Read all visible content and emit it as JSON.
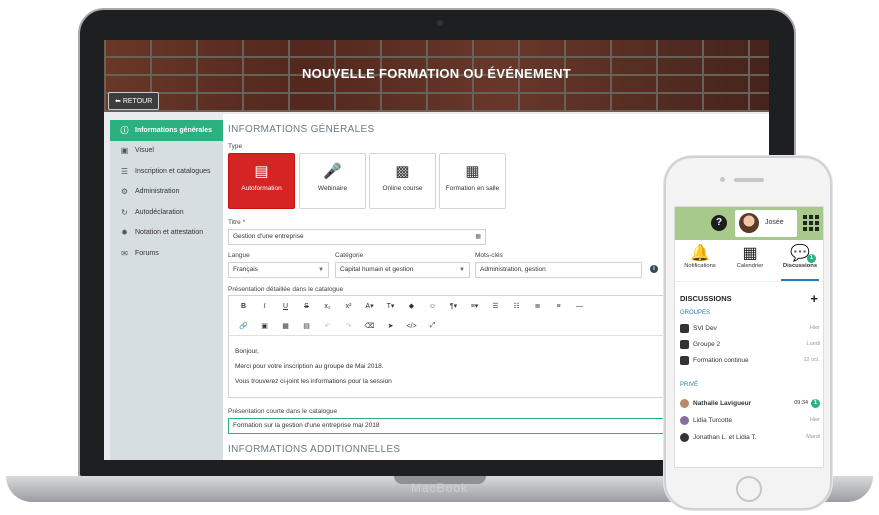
{
  "app": {
    "page_title": "NOUVELLE FORMATION OU ÉVÉNEMENT",
    "back_label": "RETOUR",
    "device_brand": "MacBook"
  },
  "sidebar": {
    "items": [
      {
        "label": "Informations générales",
        "icon": "info-icon",
        "active": true
      },
      {
        "label": "Visuel",
        "icon": "image-icon"
      },
      {
        "label": "Inscription et catalogues",
        "icon": "list-icon"
      },
      {
        "label": "Administration",
        "icon": "gear-icon"
      },
      {
        "label": "Autodéclaration",
        "icon": "sync-icon"
      },
      {
        "label": "Notation et attestation",
        "icon": "badge-icon"
      },
      {
        "label": "Forums",
        "icon": "chat-icon"
      }
    ]
  },
  "form": {
    "section_general": "INFORMATIONS GÉNÉRALES",
    "type_label": "Type",
    "types": [
      {
        "label": "Autoformation",
        "selected": true
      },
      {
        "label": "Webinaire"
      },
      {
        "label": "Online course"
      },
      {
        "label": "Formation en salle"
      }
    ],
    "title_label": "Titre *",
    "title_value": "Gestion d'une entreprise",
    "language_label": "Langue",
    "language_value": "Français",
    "category_label": "Catégorie",
    "category_value": "Capital humain et gestion",
    "keywords_label": "Mots-clés",
    "keywords_value": "Administration, gestion",
    "detailed_label": "Présentation détaillée dans le catalogue",
    "toolbar_row1": [
      "B",
      "I",
      "U",
      "S",
      "x₂",
      "x²",
      "A▾",
      "T▾",
      "◆",
      "☺",
      "¶▾",
      "≡▾",
      "☰",
      "☷",
      "≣",
      "≡",
      "—"
    ],
    "toolbar_row2": [
      "🔗",
      "▣",
      "▦",
      "▤",
      "↶",
      "↷",
      "⌫",
      "➤",
      "</>",
      "⤢"
    ],
    "editor_lines": [
      "Bonjour,",
      "Merci pour votre inscription au groupe de Mai 2018.",
      "Vous trouverez ci-joint les informations pour la session"
    ],
    "short_label": "Présentation courte dans le catalogue",
    "short_value": "Formation sur la gestion d'une entreprise mai 2018",
    "section_additional": "INFORMATIONS ADDITIONNELLES"
  },
  "phone": {
    "user_name": "Josée",
    "tabs": [
      {
        "label": "Notifications"
      },
      {
        "label": "Calendrier"
      },
      {
        "label": "Discussions",
        "active": true,
        "badge": "1"
      }
    ],
    "discussions_title": "DISCUSSIONS",
    "groups_label": "GROUPES",
    "groups": [
      {
        "name": "SVI Dev",
        "time": "Hier"
      },
      {
        "name": "Groupe 2",
        "time": "Lundi"
      },
      {
        "name": "Formation continue",
        "time": "12 oct."
      }
    ],
    "private_label": "PRIVÉ",
    "private": [
      {
        "name": "Nathalie Lavigueur",
        "time": "09:34",
        "badge": "1",
        "unread": true
      },
      {
        "name": "Lidia Turcotte",
        "time": "Hier"
      },
      {
        "name": "Jonathan L. et Lidia T.",
        "time": "Mardi"
      }
    ]
  },
  "colors": {
    "accent_green": "#2bb07f",
    "selected_red": "#d52424",
    "link_blue": "#2a7ab8"
  }
}
